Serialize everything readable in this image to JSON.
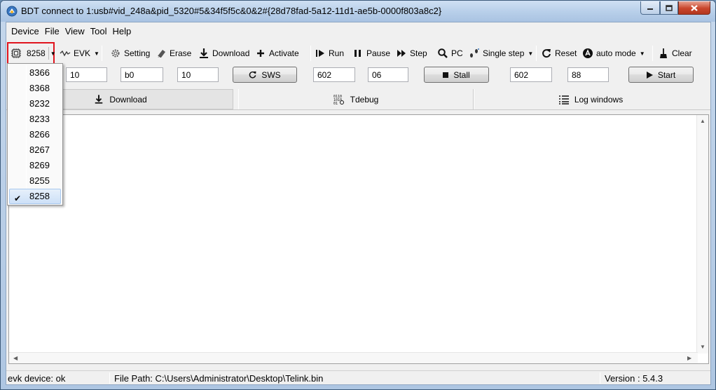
{
  "window": {
    "title": "BDT connect to 1:usb#vid_248a&pid_5320#5&34f5f5c&0&2#{28d78fad-5a12-11d1-ae5b-0000f803a8c2}",
    "app_icon": "bdt-app-icon",
    "controls": {
      "minimize": "minimize-icon",
      "maximize": "maximize-icon",
      "close": "close-icon"
    }
  },
  "menu": [
    "Device",
    "File",
    "View",
    "Tool",
    "Help"
  ],
  "toolbar": {
    "chip": {
      "label": "8258",
      "icon": "chip-icon"
    },
    "evk": {
      "label": "EVK",
      "icon": "waveform-icon"
    },
    "setting": {
      "label": "Setting",
      "icon": "gear-icon"
    },
    "erase": {
      "label": "Erase",
      "icon": "eraser-icon"
    },
    "download": {
      "label": "Download",
      "icon": "download-arrow-icon"
    },
    "activate": {
      "label": "Activate",
      "icon": "plus-icon"
    },
    "run": {
      "label": "Run",
      "icon": "run-icon"
    },
    "pause": {
      "label": "Pause",
      "icon": "pause-icon"
    },
    "step": {
      "label": "Step",
      "icon": "step-icon"
    },
    "pc": {
      "label": "PC",
      "icon": "magnifier-icon"
    },
    "single_step": {
      "label": "Single step",
      "icon": "footsteps-icon"
    },
    "reset": {
      "label": "Reset",
      "icon": "reset-icon"
    },
    "auto_mode": {
      "label": "auto mode",
      "icon": "auto-mode-icon"
    },
    "clear": {
      "label": "Clear",
      "icon": "broom-icon"
    }
  },
  "params": {
    "field1": "10",
    "field2": "b0",
    "field3": "10",
    "sws_button": "SWS",
    "field4": "602",
    "field5": "06",
    "stall_button": "Stall",
    "field6": "602",
    "field7": "88",
    "start_button": "Start"
  },
  "tabs": [
    {
      "label": "Download",
      "icon": "download-arrow-icon"
    },
    {
      "label": "Tdebug",
      "icon": "binary-search-icon"
    },
    {
      "label": "Log windows",
      "icon": "list-icon"
    }
  ],
  "chip_dropdown": {
    "items": [
      "8366",
      "8368",
      "8232",
      "8233",
      "8266",
      "8267",
      "8269",
      "8255",
      "8258"
    ],
    "selected": "8258"
  },
  "status": {
    "device": "evk device: ok",
    "file_path": "File Path:  C:\\Users\\Administrator\\Desktop\\Telink.bin",
    "version": "Version : 5.4.3"
  },
  "colors": {
    "highlight": "#e0141e",
    "selection": "#cde0f7"
  }
}
